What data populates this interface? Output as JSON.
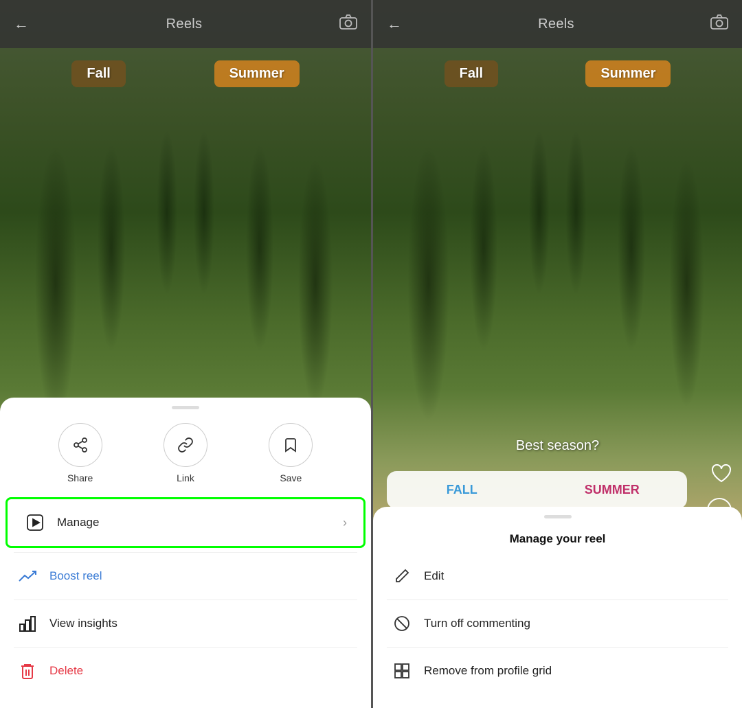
{
  "left_panel": {
    "header": {
      "title": "Reels",
      "back_arrow": "←",
      "camera_icon": "📷"
    },
    "season_tags": {
      "fall": "Fall",
      "summer": "Summer"
    },
    "bottom_sheet": {
      "actions": [
        {
          "id": "share",
          "label": "Share",
          "icon": "share"
        },
        {
          "id": "link",
          "label": "Link",
          "icon": "link"
        },
        {
          "id": "save",
          "label": "Save",
          "icon": "bookmark"
        }
      ],
      "menu_items": [
        {
          "id": "manage",
          "label": "Manage",
          "icon": "tv",
          "chevron": true,
          "highlighted": true
        },
        {
          "id": "boost",
          "label": "Boost reel",
          "icon": "trend",
          "color": "blue"
        },
        {
          "id": "insights",
          "label": "View insights",
          "icon": "bar-chart",
          "color": "default"
        },
        {
          "id": "delete",
          "label": "Delete",
          "icon": "trash",
          "color": "red"
        }
      ]
    }
  },
  "right_panel": {
    "header": {
      "title": "Reels",
      "back_arrow": "←",
      "camera_icon": "📷"
    },
    "season_tags": {
      "fall": "Fall",
      "summer": "Summer"
    },
    "poll": {
      "question": "Best season?",
      "option_fall": "FALL",
      "option_summer": "SUMMER"
    },
    "manage_sheet": {
      "title": "Manage your reel",
      "items": [
        {
          "id": "edit",
          "label": "Edit",
          "icon": "pencil"
        },
        {
          "id": "commenting",
          "label": "Turn off commenting",
          "icon": "no-comment"
        },
        {
          "id": "profile-grid",
          "label": "Remove from profile grid",
          "icon": "grid"
        }
      ]
    }
  }
}
